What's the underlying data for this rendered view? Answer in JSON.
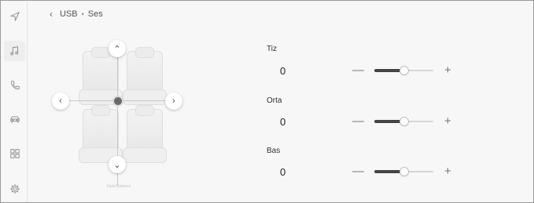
{
  "sidebar": {
    "items": [
      {
        "icon": "navigation-icon",
        "active": false
      },
      {
        "icon": "music-note-icon",
        "active": true
      },
      {
        "icon": "phone-icon",
        "active": false
      },
      {
        "icon": "car-icon",
        "active": false
      },
      {
        "icon": "apps-grid-icon",
        "active": false
      },
      {
        "icon": "settings-gear-icon",
        "active": false
      }
    ]
  },
  "breadcrumb": {
    "back_icon": "chevron-left-icon",
    "source": "USB",
    "separator": "•",
    "page": "Ses"
  },
  "seat_panel": {
    "caption": "Fade/Balance",
    "arrows": {
      "up": "^",
      "down": "v",
      "left": "<",
      "right": ">"
    },
    "fade_value": 0,
    "balance_value": 0
  },
  "equalizer": {
    "minus_symbol": "—",
    "plus_symbol": "+",
    "bands": [
      {
        "label": "Tiz",
        "value": "0",
        "level": 0.5
      },
      {
        "label": "Orta",
        "value": "0",
        "level": 0.5
      },
      {
        "label": "Bas",
        "value": "0",
        "level": 0.5
      }
    ]
  },
  "colors": {
    "accent": "#444444",
    "track": "#d6d6d6",
    "background": "#f7f7f7"
  }
}
